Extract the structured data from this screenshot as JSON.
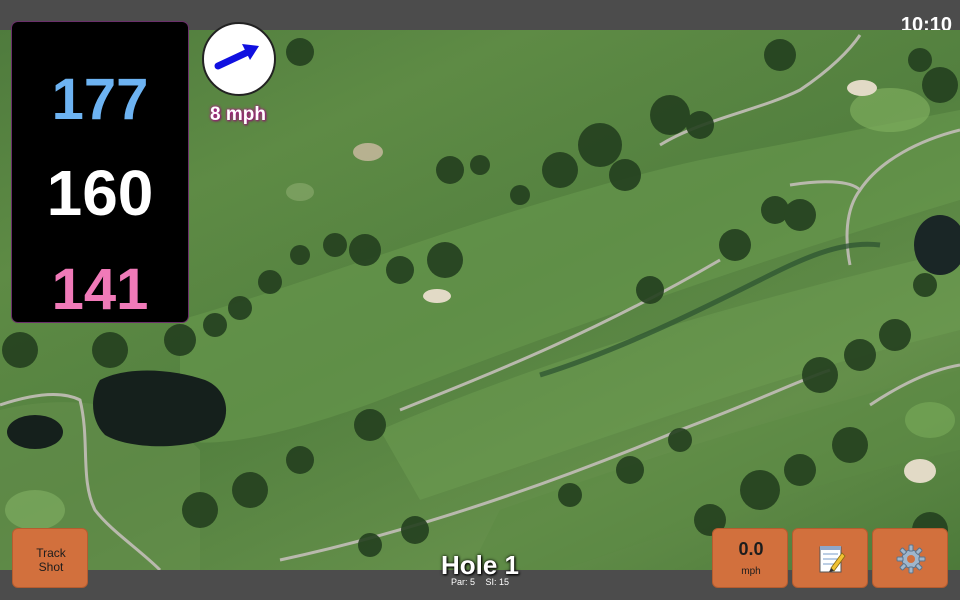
{
  "status_bar": {
    "time": "10:10"
  },
  "yardage": {
    "back": "177",
    "center": "160",
    "front": "141"
  },
  "wind": {
    "speed": "8 mph",
    "direction_icon": "arrow-icon"
  },
  "hole": {
    "title": "Hole 1",
    "par": "Par: 5",
    "stroke_index": "SI: 15"
  },
  "buttons": {
    "track_shot": "Track\nShot",
    "speed_value": "0.0",
    "speed_unit": "mph",
    "notes_icon": "notepad-icon",
    "settings_icon": "gear-icon"
  },
  "colors": {
    "back_yardage": "#6db3f2",
    "center_yardage": "#ffffff",
    "front_yardage": "#f07ab8",
    "button": "#d2703d",
    "wind_arrow": "#1010e0"
  }
}
